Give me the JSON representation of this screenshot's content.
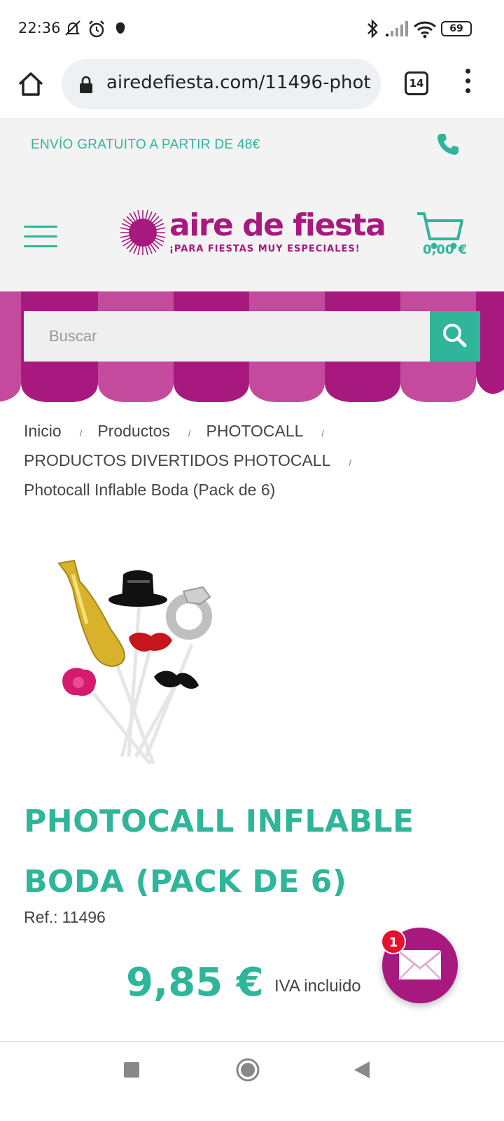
{
  "status_bar": {
    "time": "22:36",
    "battery": "69"
  },
  "browser": {
    "url": "airedefiesta.com/11496-phot",
    "tab_count": "14"
  },
  "promo": {
    "shipping": "ENVÍO GRATUITO A PARTIR DE 48€"
  },
  "header": {
    "logo_name": "aire de fiesta",
    "logo_tagline": "¡PARA FIESTAS MUY ESPECIALES!",
    "cart_total": "0,00 €"
  },
  "search": {
    "placeholder": "Buscar"
  },
  "breadcrumb": {
    "items": [
      "Inicio",
      "Productos",
      "PHOTOCALL",
      "PRODUCTOS DIVERTIDOS PHOTOCALL",
      "Photocall Inflable Boda (Pack de 6)"
    ]
  },
  "product": {
    "title_line1": "PHOTOCALL INFLABLE",
    "title_line2": "BODA (PACK DE 6)",
    "ref_label": "Ref.:",
    "ref_value": "11496",
    "price": "9,85 €",
    "tax_note": "IVA incluido"
  },
  "chat": {
    "badge_count": "1"
  },
  "colors": {
    "accent_green": "#2fb59a",
    "brand_magenta": "#a8197f",
    "badge_red": "#e8112d"
  }
}
